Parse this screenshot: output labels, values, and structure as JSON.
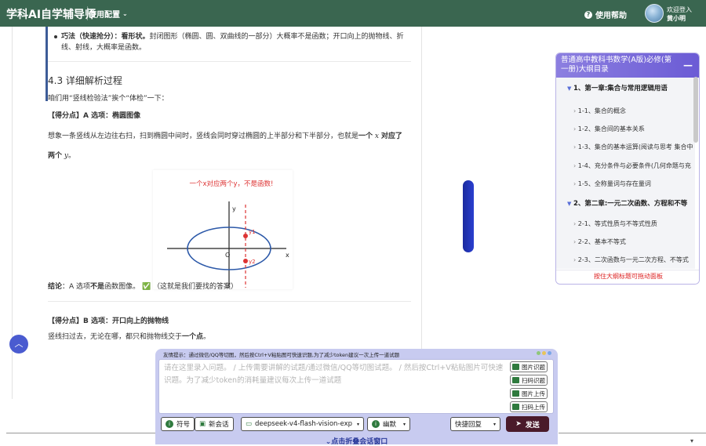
{
  "header": {
    "brand": "学科AI自学辅导师",
    "config_label": "使用配置",
    "help_label": "使用帮助",
    "login_label": "欢迎登入",
    "user_name": "黄小明",
    "bg_color": "#3a6650"
  },
  "doc": {
    "bullet_label": "巧法（快速抢分）：看形状。",
    "bullet_text": "封闭图形（椭圆、圆、双曲线的一部分）大概率不是函数；开口向上的抛物线、折",
    "bullet_text2": "线、射线，大概率是函数。",
    "section_title": "4.3 详细解析过程",
    "intro": "咱们用“竖线检验法”挨个“体检”一下：",
    "pointA_label": "【得分点】A 选项：椭圆图像",
    "pointA_text_1": "想象一条竖线从左边往右扫，扫到椭圆中间时，竖线会同时穿过椭圆的上半部分和下半部分，也就是",
    "pointA_bold_1": "一个",
    "pointA_var_x": "x",
    "pointA_bold_2": "对应了",
    "pointA_bold_3": "两个",
    "pointA_var_y": "y",
    "pointA_end": "。",
    "figure": {
      "caption": "一个x对应两个y，不是函数!",
      "label_y1": "y1",
      "label_y2": "y2",
      "label_o": "O",
      "label_x": "x",
      "label_y": "y"
    },
    "conclusion_label": "结论",
    "conclusion_text_1": "：A 选项",
    "conclusion_bold": "不是",
    "conclusion_text_2": "函数图像。",
    "conclusion_check": "✅",
    "conclusion_note": "（这就是我们要找的答案）",
    "pointB_label": "【得分点】B 选项：开口向上的抛物线",
    "pointB_text": "竖线扫过去，无论在哪，都只和抛物线交于",
    "pointB_bold": "一个点",
    "pointB_end": "。"
  },
  "outline": {
    "title": "普通高中教科书数学(A版)必修(第一册)大纲目录",
    "minimize": "—",
    "items": [
      {
        "text": "1、第一章:集合与常用逻辑用语",
        "chapter": true
      },
      {
        "text": "1-1、集合的概念",
        "chapter": false
      },
      {
        "text": "1-2、集合间的基本关系",
        "chapter": false
      },
      {
        "text": "1-3、集合的基本运算(阅读与思考 集合中",
        "chapter": false
      },
      {
        "text": "1-4、充分条件与必要条件(几何命题与充",
        "chapter": false
      },
      {
        "text": "1-5、全称量词与存在量词",
        "chapter": false
      },
      {
        "text": "2、第二章:一元二次函数、方程和不等",
        "chapter": true
      },
      {
        "text": "2-1、等式性质与不等式性质",
        "chapter": false
      },
      {
        "text": "2-2、基本不等式",
        "chapter": false
      },
      {
        "text": "2-3、二次函数与一元二次方程、不等式",
        "chapter": false
      }
    ],
    "tip": "按住大纲标题可拖动面板"
  },
  "chat": {
    "tip": "友情提示：通过微信/QQ等切图，然后按Ctrl+V粘贴图可快速识题,为了减少token建议一次上传一道试题",
    "placeholder": "请在这里录入问题。 / 上传需要讲解的试题/通过微信/QQ等切图试题。 / 然后按Ctrl+V粘贴图片可快速识题。为了减少token的消耗量建议每次上传一道试题",
    "side_buttons": [
      "图片识题",
      "扫码识题",
      "图片上传",
      "扫码上传"
    ],
    "symbol": "符号",
    "new_chat": "新会话",
    "model": "deepseek-v4-flash-vision-exp",
    "style": "幽默",
    "quick_reply": "快捷回复",
    "send": "发送",
    "collapse": "点击折叠会话窗口"
  }
}
